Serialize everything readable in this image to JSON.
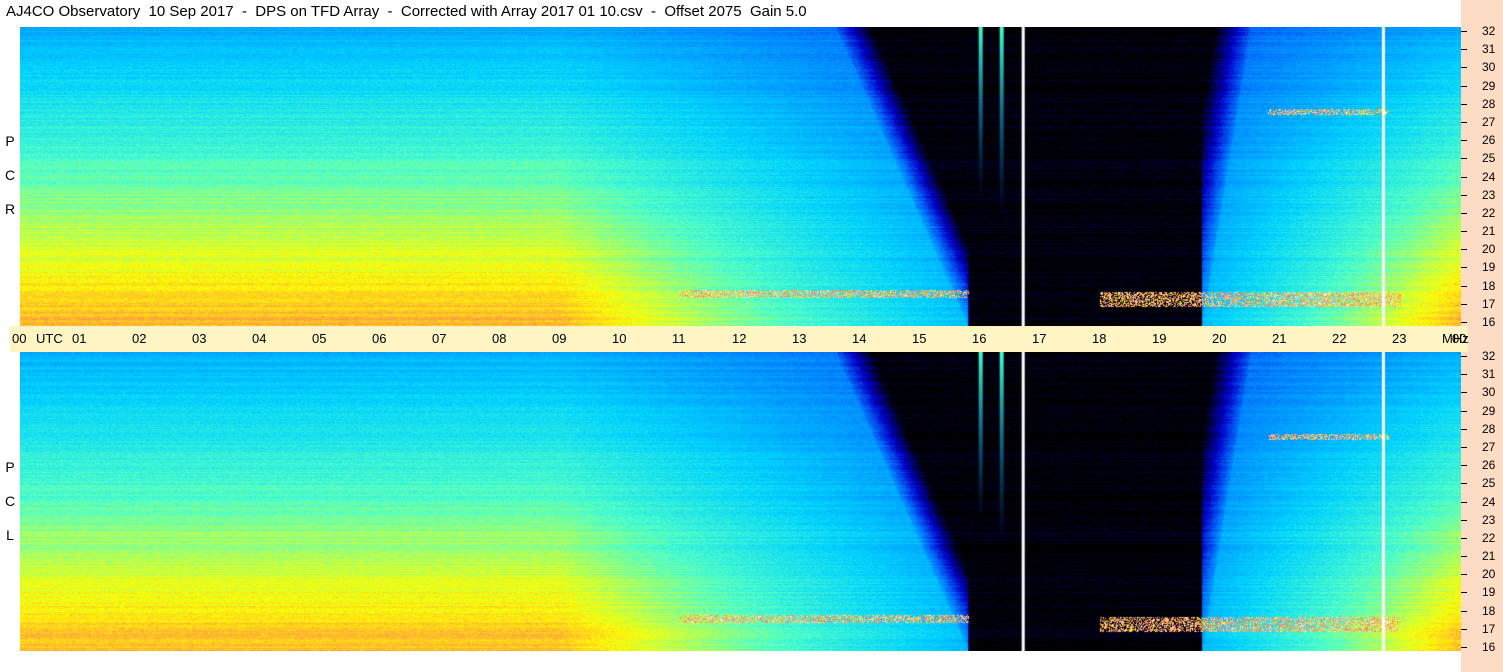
{
  "title": "AJ4CO Observatory  10 Sep 2017  -  DPS on TFD Array  -  Corrected with Array 2017 01 10.csv  -  Offset 2075  Gain 5.0",
  "panels": {
    "top": {
      "label_letters": [
        "P",
        "C",
        "R"
      ]
    },
    "bottom": {
      "label_letters": [
        "P",
        "C",
        "L"
      ]
    }
  },
  "time_axis": {
    "utc_label": "UTC",
    "mhz_label": "MHz",
    "hour_labels": [
      "00",
      "01",
      "02",
      "03",
      "04",
      "05",
      "06",
      "07",
      "08",
      "09",
      "10",
      "11",
      "12",
      "13",
      "14",
      "15",
      "16",
      "17",
      "18",
      "19",
      "20",
      "21",
      "22",
      "23",
      "00"
    ]
  },
  "freq_axis": {
    "labels": [
      "32",
      "31",
      "30",
      "29",
      "28",
      "27",
      "26",
      "25",
      "24",
      "23",
      "22",
      "21",
      "20",
      "19",
      "18",
      "17",
      "16"
    ]
  },
  "colors": {
    "background": "#ffffff",
    "right_strip": "#fcdcc4",
    "axis_band": "#fff4c4"
  },
  "chart_data": {
    "type": "heatmap",
    "title": "AJ4CO Observatory  10 Sep 2017  -  DPS on TFD Array  -  Corrected with Array 2017 01 10.csv  -  Offset 2075  Gain 5.0",
    "x_range_utc_hours": [
      0,
      24
    ],
    "y_range_mhz": [
      16,
      32
    ],
    "colormap": [
      "#000000",
      "#0000c8",
      "#0078ff",
      "#00d2ff",
      "#50ffc8",
      "#ffff00",
      "#ff6464",
      "#ffffff"
    ],
    "series": [
      {
        "name": "R C P",
        "regions": [
          {
            "kind": "night_dark",
            "utc_start": 15.8,
            "utc_end": 19.7,
            "mhz_start": 16,
            "mhz_end": 32
          },
          {
            "kind": "bright_lowband",
            "utc_start": 0,
            "utc_end": 9,
            "mhz_start": 16,
            "mhz_end": 22
          },
          {
            "kind": "rfi_band",
            "utc_start": 11.0,
            "utc_end": 15.8,
            "mhz_start": 17.5,
            "mhz_end": 17.9
          },
          {
            "kind": "rfi_band",
            "utc_start": 18.0,
            "utc_end": 23.0,
            "mhz_start": 17.0,
            "mhz_end": 17.8
          },
          {
            "kind": "rfi_band",
            "utc_start": 20.8,
            "utc_end": 22.8,
            "mhz_start": 27.3,
            "mhz_end": 27.6
          },
          {
            "kind": "vertical_burst",
            "utc": 16.0,
            "mhz_start": 23,
            "mhz_end": 32
          },
          {
            "kind": "vertical_burst",
            "utc": 16.35,
            "mhz_start": 22,
            "mhz_end": 32
          },
          {
            "kind": "vertical_gap",
            "utc": 16.7
          },
          {
            "kind": "vertical_gap",
            "utc": 22.7
          }
        ]
      },
      {
        "name": "L C P",
        "regions": [
          {
            "kind": "night_dark",
            "utc_start": 15.8,
            "utc_end": 19.7,
            "mhz_start": 16,
            "mhz_end": 32
          },
          {
            "kind": "bright_lowband",
            "utc_start": 0,
            "utc_end": 9,
            "mhz_start": 16,
            "mhz_end": 22
          },
          {
            "kind": "rfi_band",
            "utc_start": 11.0,
            "utc_end": 15.8,
            "mhz_start": 17.5,
            "mhz_end": 17.9
          },
          {
            "kind": "rfi_band",
            "utc_start": 18.0,
            "utc_end": 23.0,
            "mhz_start": 17.0,
            "mhz_end": 17.8
          },
          {
            "kind": "rfi_band",
            "utc_start": 20.8,
            "utc_end": 22.8,
            "mhz_start": 27.3,
            "mhz_end": 27.6
          },
          {
            "kind": "vertical_burst",
            "utc": 16.0,
            "mhz_start": 23,
            "mhz_end": 32
          },
          {
            "kind": "vertical_burst",
            "utc": 16.35,
            "mhz_start": 22,
            "mhz_end": 32
          },
          {
            "kind": "vertical_gap",
            "utc": 16.7
          },
          {
            "kind": "vertical_gap",
            "utc": 22.7
          }
        ]
      }
    ]
  }
}
